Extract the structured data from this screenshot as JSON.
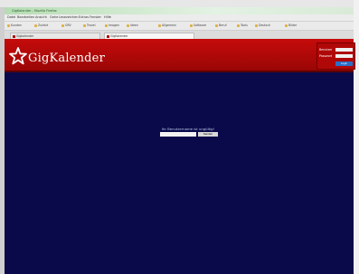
{
  "browser": {
    "window_title": "GigKalender - Mozilla Firefox",
    "menu": [
      "Datei",
      "Bearbeiten",
      "Ansicht",
      "Gehe",
      "Lesezeichen",
      "Extras",
      "Fenster",
      "Hilfe"
    ],
    "bookmarks": [
      "Kunden",
      "Zuletzt",
      "GRV",
      "Travel",
      "Imagen",
      "Ideen",
      "Allgemein",
      "Software",
      "Beruf",
      "Tools",
      "Deutsch",
      "Bilder"
    ],
    "tabs": [
      {
        "label": "Gigkalender",
        "active": false
      },
      {
        "label": "GigKalender",
        "active": true
      }
    ]
  },
  "site": {
    "logo_text": "GigKalender",
    "login": {
      "user_label": "Benutzer",
      "pass_label": "Passwort",
      "button_label": "Login"
    },
    "center": {
      "message": "Ihr Benutzername ist ungültig!",
      "button_label": "Senden"
    }
  },
  "colors": {
    "page_bg": "#0a0a4a",
    "header_red": "#c60b0b",
    "accent_blue": "#2a6fc9"
  }
}
